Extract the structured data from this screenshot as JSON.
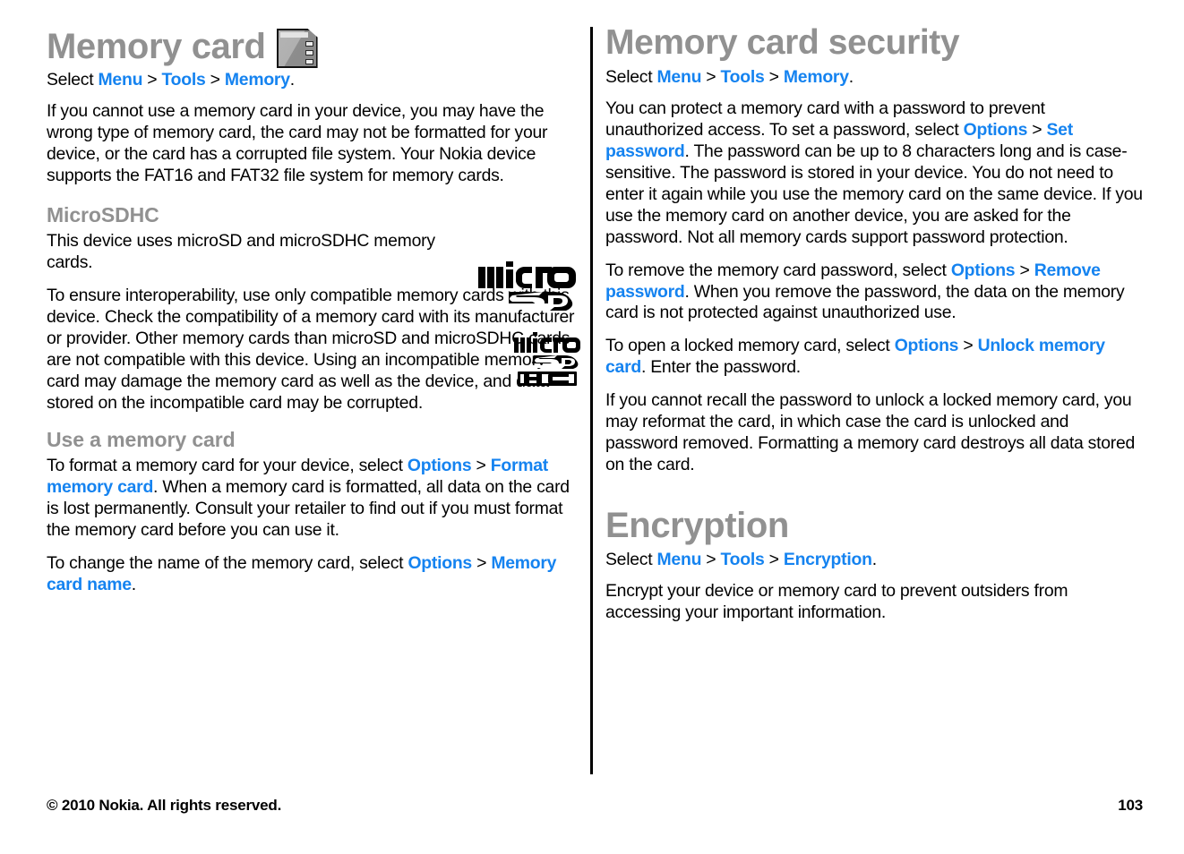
{
  "document": {
    "footer": {
      "copyright": "© 2010 Nokia. All rights reserved.",
      "page_number": "103"
    },
    "colors": {
      "heading_gray": "#919191",
      "link_blue": "#1583f0",
      "body_black": "#000000"
    }
  },
  "left_column": {
    "chapter_title": "Memory card",
    "chapter_icon": "memory-card-icon",
    "select_path": {
      "prefix": "Select ",
      "item1": "Menu",
      "sep1": " > ",
      "item2": "Tools",
      "sep2": " > ",
      "item3": "Memory",
      "suffix": "."
    },
    "intro_paragraph": "If you cannot use a memory card in your device, you may have the wrong type of memory card, the card may not be formatted for your device, or the card has a corrupted file system. Your Nokia device supports the FAT16 and FAT32 file system for memory cards.",
    "microsdhc": {
      "heading": "MicroSDHC",
      "paragraph1": "This device uses microSD and microSDHC memory cards.",
      "paragraph2": "To ensure interoperability, use only compatible memory cards with this device. Check the compatibility of a memory card with its manufacturer or provider. Other memory cards than microSD and microSDHC cards are not compatible with this device. Using an incompatible memory card may damage the memory card as well as the device, and data stored on the incompatible card may be corrupted.",
      "logo_microsd": "microsd-logo",
      "logo_microsdhc": "microsdhc-logo"
    },
    "use_a_memory_card": {
      "heading": "Use a memory card",
      "format_paragraph": {
        "part1": "To format a memory card for your device, select ",
        "link1": "Options",
        "sep": " > ",
        "link2": "Format memory card",
        "part2": ". When a memory card is formatted, all data on the card is lost permanently. Consult your retailer to find out if you must format the memory card before you can use it."
      },
      "rename_paragraph": {
        "part1": "To change the name of the memory card, select ",
        "link1": "Options",
        "sep": " > ",
        "link2": "Memory card name",
        "part2": "."
      }
    }
  },
  "right_column": {
    "chapter_title": "Memory card security",
    "select_path": {
      "prefix": "Select ",
      "item1": "Menu",
      "sep1": " > ",
      "item2": "Tools",
      "sep2": " > ",
      "item3": "Memory",
      "suffix": "."
    },
    "protect_paragraph": {
      "part1": "You can protect a memory card with a password to prevent unauthorized access. To set a password, select ",
      "link1": "Options",
      "sep": " > ",
      "link2": "Set password",
      "part2": ". The password can be up to 8 characters long and is case-sensitive. The password is stored in your device. You do not need to enter it again while you use the memory card on the same device. If you use the memory card on another device, you are asked for the password. Not all memory cards support password protection."
    },
    "remove_paragraph": {
      "part1": "To remove the memory card password, select ",
      "link1": "Options",
      "sep": " > ",
      "link2": "Remove password",
      "part2": ". When you remove the password, the data on the memory card is not protected against unauthorized use."
    },
    "unlock_paragraph": {
      "part1": "To open a locked memory card, select ",
      "link1": "Options",
      "sep": " > ",
      "link2": "Unlock memory card",
      "part2": ". Enter the password."
    },
    "recall_paragraph": "If you cannot recall the password to unlock a locked memory card, you may reformat the card, in which case the card is unlocked and password removed. Formatting a memory card destroys all data stored on the card.",
    "encryption": {
      "chapter_title": "Encryption",
      "select_path": {
        "prefix": "Select ",
        "item1": "Menu",
        "sep1": " > ",
        "item2": "Tools",
        "sep2": " > ",
        "item3": "Encryption",
        "suffix": "."
      },
      "paragraph": "Encrypt your device or memory card to prevent outsiders from accessing your important information."
    }
  }
}
